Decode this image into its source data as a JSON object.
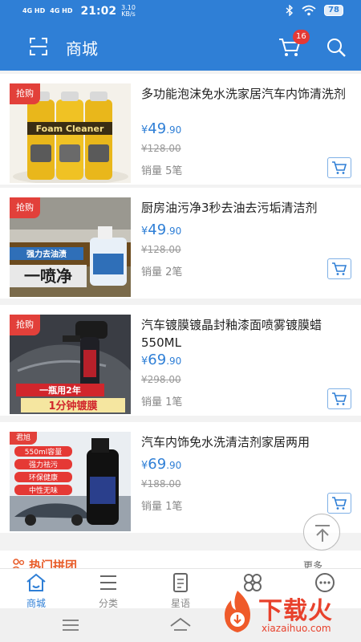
{
  "status_bar": {
    "net1": "4G HD",
    "net2": "4G HD",
    "time": "21:02",
    "speed_value": "3.10",
    "speed_unit": "KB/s",
    "battery": "78"
  },
  "header": {
    "title": "商城",
    "cart_count": "16"
  },
  "products": [
    {
      "tag": "抢购",
      "name": "多功能泡沫免水洗家居汽车内饰清洗剂",
      "currency": "¥",
      "price_int": "49",
      "price_dec": ".90",
      "original": "¥128.00",
      "sales": "销量 5笔",
      "image_text": "Foam cleaner"
    },
    {
      "tag": "抢购",
      "name": "厨房油污净3秒去油去污垢清洁剂",
      "currency": "¥",
      "price_int": "49",
      "price_dec": ".90",
      "original": "¥128.00",
      "sales": "销量 2笔",
      "image_text_1": "强力去油渍",
      "image_text_2": "一喷净"
    },
    {
      "tag": "抢购",
      "name": "汽车镀膜镀晶封釉漆面喷雾镀膜蜡550ML",
      "currency": "¥",
      "price_int": "69",
      "price_dec": ".90",
      "original": "¥298.00",
      "sales": "销量 1笔",
      "image_text_1": "一瓶用2年",
      "image_text_2": "1分钟镀膜"
    },
    {
      "tag": "君旭",
      "name": "汽车内饰免水洗清洁剂家居两用",
      "currency": "¥",
      "price_int": "69",
      "price_dec": ".90",
      "original": "¥188.00",
      "sales": "销量 1笔",
      "features": [
        "550ml容量",
        "强力祛污",
        "环保健康",
        "中性无味"
      ]
    }
  ],
  "hot_section": {
    "title": "热门拼团",
    "more": "更多"
  },
  "bottom_nav": [
    {
      "label": "商城",
      "icon": "home-icon",
      "active": true
    },
    {
      "label": "分类",
      "icon": "list-icon",
      "active": false
    },
    {
      "label": "星语",
      "icon": "note-icon",
      "active": false
    },
    {
      "label": "",
      "icon": "grid-icon",
      "active": false
    },
    {
      "label": "",
      "icon": "chat-icon",
      "active": false
    }
  ],
  "watermark": {
    "text": "下载火",
    "sub": "xiazaihuo.com"
  },
  "colors": {
    "primary": "#2f7fd6",
    "tag_red": "#e2403a",
    "badge_red": "#e53935"
  }
}
